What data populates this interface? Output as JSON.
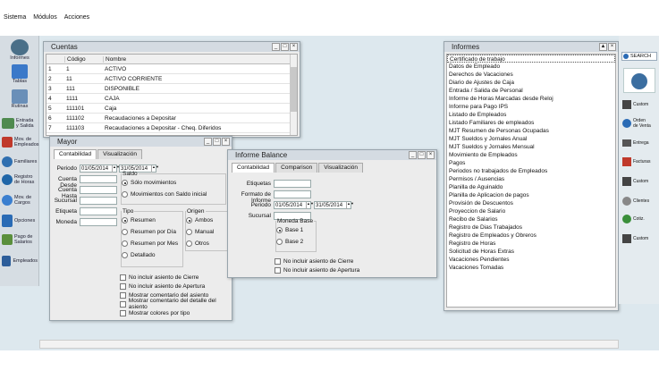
{
  "menu": [
    "Sistema",
    "Módulos",
    "Acciones"
  ],
  "sidebar": [
    {
      "label": "Informes",
      "icon": "reports-icon"
    },
    {
      "label": "Tablas",
      "icon": "tables-icon"
    },
    {
      "label": "Rutinas",
      "icon": "routines-icon"
    },
    {
      "label": "Entrada y Salida",
      "icon": "entry-exit-icon"
    },
    {
      "label": "Mov. de Empleados",
      "icon": "employee-movement-icon"
    },
    {
      "label": "Familiares",
      "icon": "family-icon"
    },
    {
      "label": "Registro de Horas",
      "icon": "hours-icon"
    },
    {
      "label": "Mov. de Cargos",
      "icon": "positions-icon"
    },
    {
      "label": "Opciones",
      "icon": "options-icon"
    },
    {
      "label": "Pago de Salarios",
      "icon": "salary-icon"
    },
    {
      "label": "Empleados",
      "icon": "employees-icon"
    }
  ],
  "cuentas": {
    "title": "Cuentas",
    "headers": [
      "Código",
      "Nombre"
    ],
    "rows": [
      {
        "n": "1",
        "codigo": "1",
        "nombre": "ACTIVO"
      },
      {
        "n": "2",
        "codigo": "11",
        "nombre": "ACTIVO CORRIENTE"
      },
      {
        "n": "3",
        "codigo": "111",
        "nombre": "DISPONIBLE"
      },
      {
        "n": "4",
        "codigo": "1111",
        "nombre": "CAJA"
      },
      {
        "n": "5",
        "codigo": "111101",
        "nombre": "Caja"
      },
      {
        "n": "6",
        "codigo": "111102",
        "nombre": "Recaudaciones a Depositar"
      },
      {
        "n": "7",
        "codigo": "111103",
        "nombre": "Recaudaciones a Depositar - Cheq. Diferidos"
      }
    ]
  },
  "mayor": {
    "title": "Mayor",
    "tabs": [
      "Contabilidad",
      "Visualización"
    ],
    "periodo_label": "Periodo",
    "date_from": "01/05/2014",
    "date_to": "31/05/2014",
    "fields": [
      "Cuenta Desde",
      "Cuenta Hasta",
      "Sucursal",
      "Etiqueta",
      "Moneda"
    ],
    "saldo": {
      "legend": "Saldo",
      "options": [
        "Sólo movimientos",
        "Movimientos con Saldo inicial"
      ],
      "selected": 0
    },
    "tipo": {
      "legend": "Tipo",
      "options": [
        "Resumen",
        "Resumen por Día",
        "Resumen por Mes",
        "Detallado"
      ],
      "selected": 0
    },
    "origen": {
      "legend": "Origen",
      "options": [
        "Ambos",
        "Manual",
        "Otros"
      ],
      "selected": 0
    },
    "checks": [
      "No incluir asiento de Cierre",
      "No incluir asiento de Apertura",
      "Mostrar comentario del asiento",
      "Mostrar comentario del detalle del asiento",
      "Mostrar colores por tipo"
    ]
  },
  "balance": {
    "title": "Informe Balance",
    "tabs": [
      "Contabilidad",
      "Comparison",
      "Visualización"
    ],
    "fields": [
      "Etiquetas",
      "Formato de Informe"
    ],
    "periodo_label": "Periodo",
    "date_from": "01/05/2014",
    "date_to": "31/05/2014",
    "sucursal_label": "Sucursal",
    "moneda": {
      "legend": "Moneda Base",
      "options": [
        "Base 1",
        "Base 2"
      ],
      "selected": 0
    },
    "checks": [
      "No incluir asiento de Cierre",
      "No incluir asiento de Apertura"
    ]
  },
  "informes": {
    "title": "Informes",
    "items": [
      "Certificado de trabajo",
      "Datos de Empleado",
      "Derechos de Vacaciones",
      "Diario de Ajustes de Caja",
      "Entrada / Salida de Personal",
      "Informe de Horas Marcadas desde Reloj",
      "Informe para Pago IPS",
      "Listado de Empleados",
      "Listado Familiares de empleados",
      "MJT Resumen de Personas Ocupadas",
      "MJT Sueldos y Jornales Anual",
      "MJT Sueldos y Jornales Mensual",
      "Movimiento de Empleados",
      "Pagos",
      "Periodos no trabajados de Empleados",
      "Permisos / Ausencias",
      "Planilla de Aguinaldo",
      "Planilla de Aplicacion de pagos",
      "Provisión de Descuentos",
      "Proyeccion de Salario",
      "Recibo de Salarios",
      "Registro de Dias Trabajados",
      "Registro de Empleados y Obreros",
      "Registro de Horas",
      "Solicitud de Horas Extras",
      "Vacaciones Pendientes",
      "Vacaciones Tomadas"
    ]
  },
  "right": {
    "search": "SEARCH",
    "items": [
      "Custom",
      "Orden de Venta",
      "Entrega",
      "Facturas",
      "Custom",
      "Clientes",
      "Cotiz.",
      "Custom"
    ]
  }
}
